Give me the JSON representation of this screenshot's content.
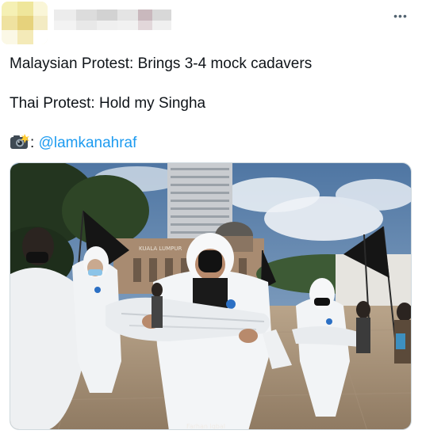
{
  "tweet": {
    "more_label": "•••",
    "text_line1": "Malaysian Protest: Brings 3-4 mock cadavers",
    "text_line2": "Thai Protest: Hold my Singha",
    "camera_icon": "camera-with-flash-icon",
    "photo_credit_separator": ": ",
    "mention": "@lamkanahraf",
    "photo": {
      "building_sign": "KUALA LUMPUR",
      "watermark": "Farhan iqbal"
    }
  },
  "colors": {
    "text": "#0f1419",
    "mention": "#1d9bf0",
    "muted": "#536471",
    "border": "#cfd9de"
  }
}
